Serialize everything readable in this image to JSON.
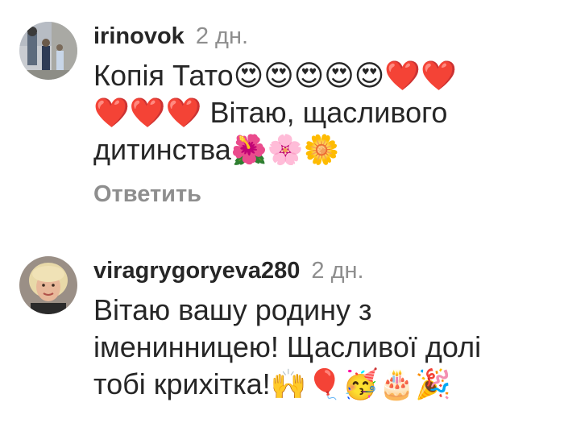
{
  "comments": [
    {
      "username": "irinovok",
      "time": "2 дн.",
      "text_lines": [
        "Копія Тато😍😍😍😍😍❤️❤️",
        "❤️❤️❤️ Вітаю, щасливого",
        "дитинства🌺🌸🌼"
      ],
      "reply_label": "Ответить",
      "avatar_icon": "family-photo-avatar"
    },
    {
      "username": "viragrygoryeva280",
      "time": "2 дн.",
      "text_lines": [
        "Вітаю вашу родину з",
        "іменинницею! Щасливої долі",
        "тобі крихітка!🙌🎈🥳🎂🎉"
      ],
      "avatar_icon": "woman-portrait-avatar"
    }
  ],
  "colors": {
    "username": "#262626",
    "time": "#8e8e8e",
    "text": "#262626",
    "reply": "#8e8e8e"
  }
}
